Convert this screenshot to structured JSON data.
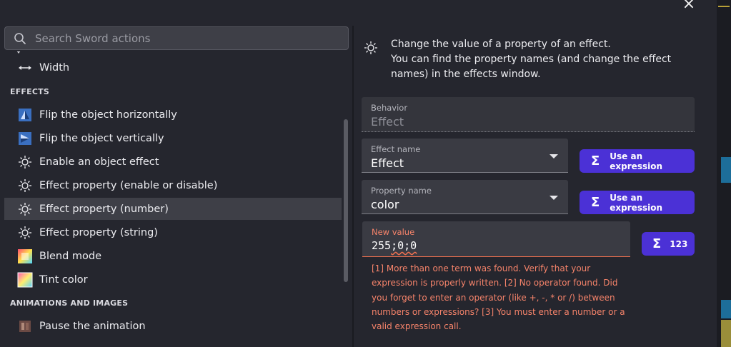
{
  "search": {
    "placeholder": "Search Sword actions"
  },
  "list": {
    "width_item": "Width",
    "effects_section": "EFFECTS",
    "effects": [
      "Flip the object horizontally",
      "Flip the object vertically",
      "Enable an object effect",
      "Effect property (enable or disable)",
      "Effect property (number)",
      "Effect property (string)",
      "Blend mode",
      "Tint color"
    ],
    "anim_section": "ANIMATIONS AND IMAGES",
    "anim": [
      "Pause the animation"
    ]
  },
  "description": {
    "line1": "Change the value of a property of an effect.",
    "line2": "You can find the property names (and change the effect names) in the effects window."
  },
  "fields": {
    "behavior": {
      "label": "Behavior",
      "value": "Effect"
    },
    "effect_name": {
      "label": "Effect name",
      "value": "Effect"
    },
    "property_name": {
      "label": "Property name",
      "value": "color"
    },
    "new_value": {
      "label": "New value",
      "value_a": "255",
      "value_b": ";0;0"
    }
  },
  "buttons": {
    "use_expression": "Use an expression",
    "numeric": "123"
  },
  "error_text": "[1] More than one term was found. Verify that your expression is properly written. [2] No operator found. Did you forget to enter an operator (like +, -, * or /) between numbers or expressions? [3] You must enter a number or a valid expression call.",
  "colors": {
    "accent": "#4b31d6",
    "error": "#f5836a",
    "panel": "#25262e"
  }
}
